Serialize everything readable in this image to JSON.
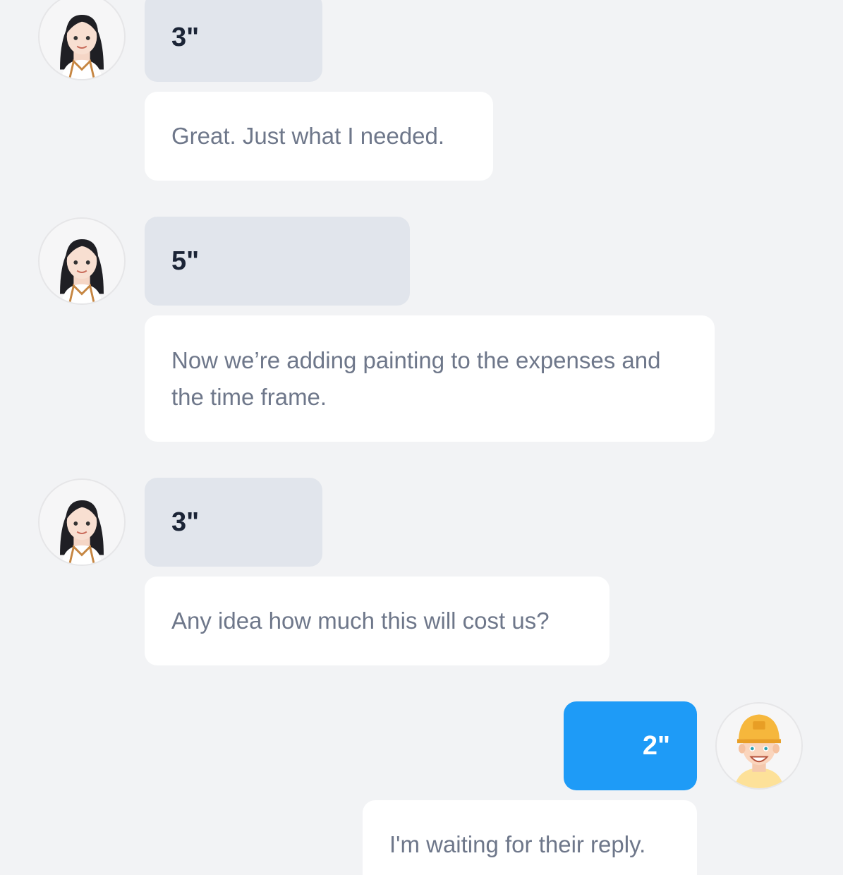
{
  "messages": [
    {
      "sender": "girl",
      "duration": "3\"",
      "text": "Great. Just what I needed."
    },
    {
      "sender": "girl",
      "duration": "5\"",
      "text": "Now we’re adding painting to the expenses and the time frame."
    },
    {
      "sender": "girl",
      "duration": "3\"",
      "text": "Any idea how much this will cost us?"
    },
    {
      "sender": "me",
      "duration": "2\"",
      "text": "I'm waiting for their reply."
    }
  ],
  "avatars": {
    "girl": "girl-avatar-icon",
    "me": "boy-cap-avatar-icon"
  },
  "colors": {
    "background": "#f2f3f5",
    "incoming_duration_bubble": "#e1e5ec",
    "outgoing_duration_bubble": "#1e9bf7",
    "message_bubble": "#ffffff",
    "message_text": "#6e778a",
    "duration_text": "#1b2436"
  }
}
